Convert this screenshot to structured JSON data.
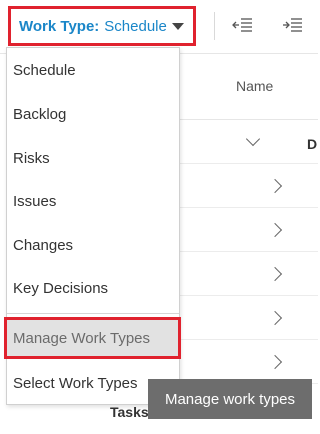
{
  "toolbar": {
    "work_type_label": "Work Type:",
    "work_type_value": "Schedule",
    "outdent_icon": "outdent-icon",
    "indent_icon": "indent-icon"
  },
  "grid": {
    "column_name": "Name",
    "cut_column_letter": "D",
    "tasks_label": "Tasks"
  },
  "menu": {
    "items": [
      {
        "label": "Schedule"
      },
      {
        "label": "Backlog"
      },
      {
        "label": "Risks"
      },
      {
        "label": "Issues"
      },
      {
        "label": "Changes"
      },
      {
        "label": "Key Decisions"
      },
      {
        "label": "Manage Work Types",
        "state": "hovered"
      },
      {
        "label": "Select Work Types"
      }
    ]
  },
  "tooltip": {
    "text": "Manage work types"
  },
  "colors": {
    "accent_blue": "#1a86c8",
    "highlight_red": "#e0222e",
    "hover_gray": "#e2e2e2",
    "tooltip_bg": "#6d6d6d"
  }
}
